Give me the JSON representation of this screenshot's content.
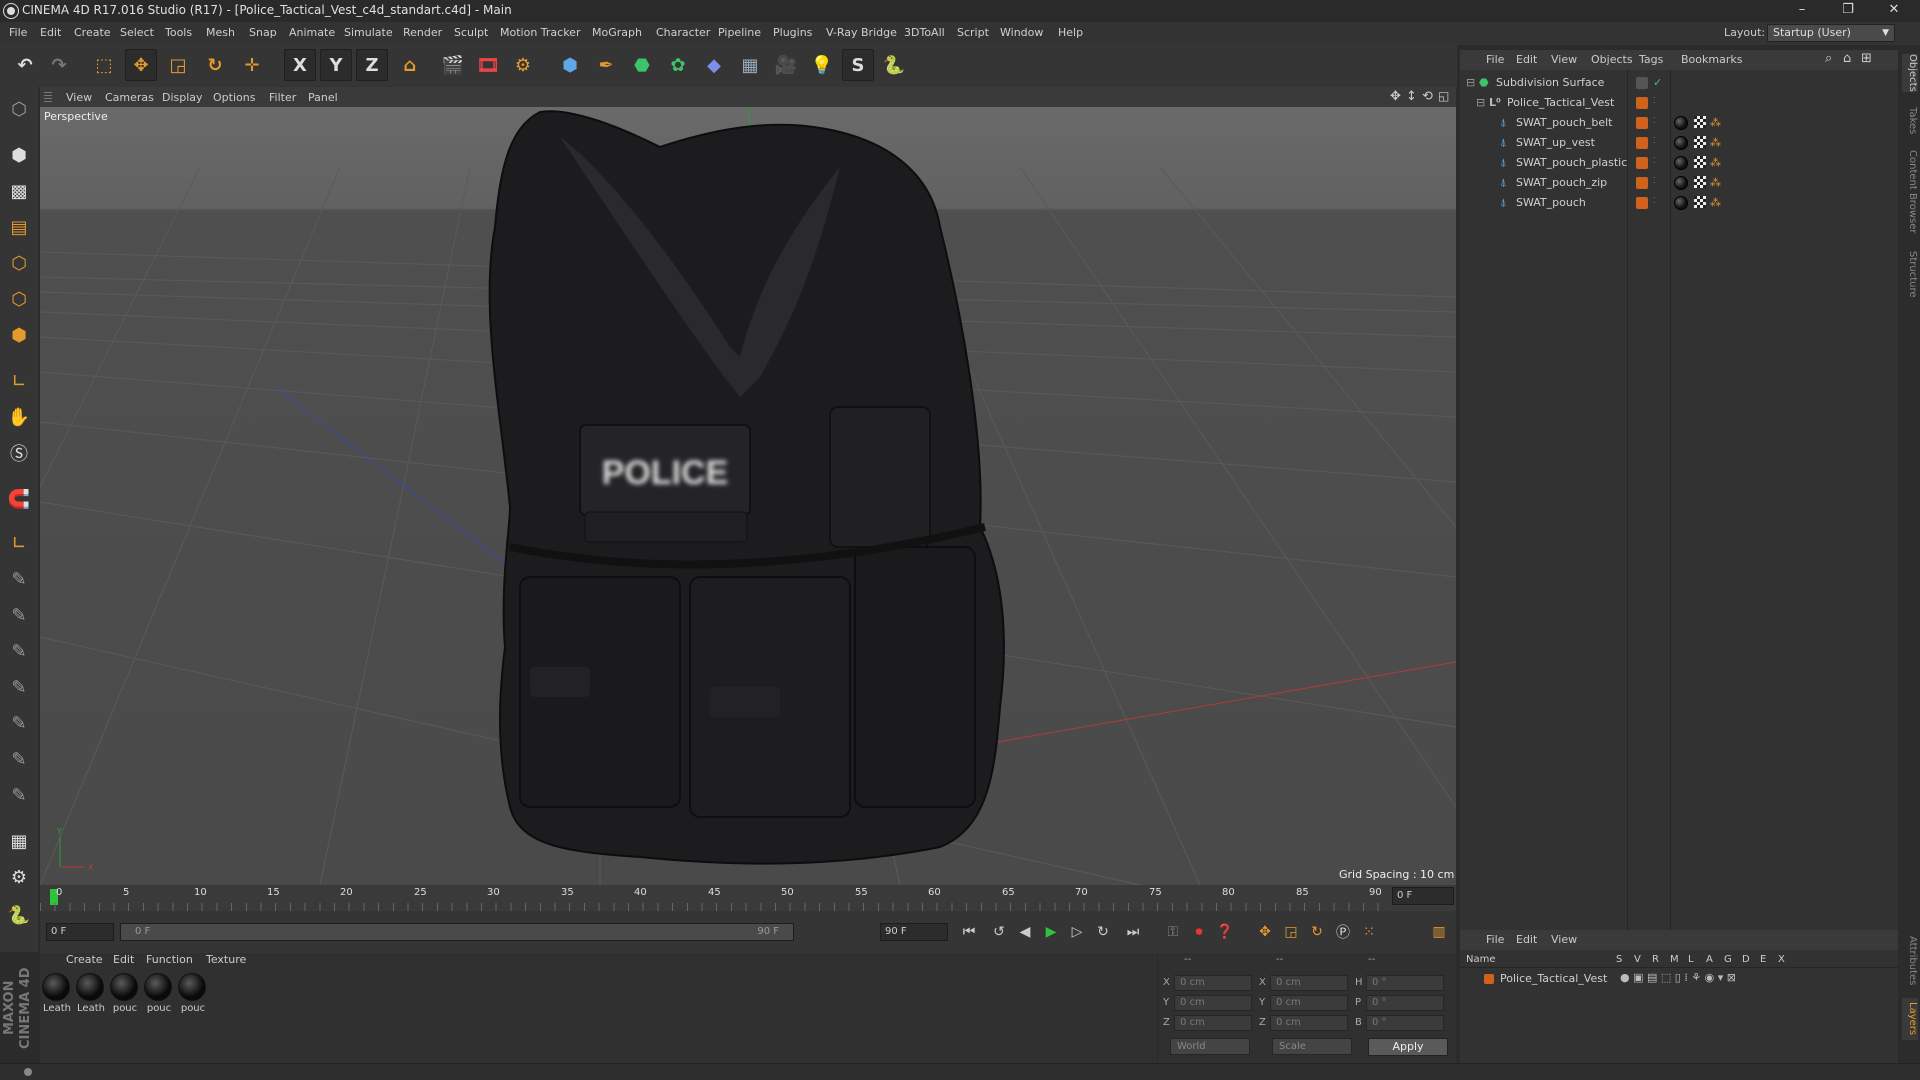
{
  "window": {
    "title": "CINEMA 4D R17.016 Studio (R17) - [Police_Tactical_Vest_c4d_standart.c4d] - Main",
    "minimize_glyph": "–",
    "restore_glyph": "❐",
    "close_glyph": "✕"
  },
  "menubar": {
    "items": [
      "File",
      "Edit",
      "Create",
      "Select",
      "Tools",
      "Mesh",
      "Snap",
      "Animate",
      "Simulate",
      "Render",
      "Sculpt",
      "Motion Tracker",
      "MoGraph",
      "Character",
      "Pipeline",
      "Plugins",
      "V-Ray Bridge",
      "3DToAll",
      "Script",
      "Window",
      "Help"
    ],
    "layout_label": "Layout:",
    "layout_value": "Startup (User)"
  },
  "toolbar": {
    "axis_x": "X",
    "axis_y": "Y",
    "axis_z": "Z"
  },
  "viewport": {
    "menu": [
      "View",
      "Cameras",
      "Display",
      "Options",
      "Filter",
      "Panel"
    ],
    "label": "Perspective",
    "grid_spacing": "Grid Spacing : 10 cm",
    "vest_patch_text": "POLICE",
    "axis_y": "Y",
    "axis_x": "X"
  },
  "timeline": {
    "ticks": [
      "0",
      "5",
      "10",
      "15",
      "20",
      "25",
      "30",
      "35",
      "40",
      "45",
      "50",
      "55",
      "60",
      "65",
      "70",
      "75",
      "80",
      "85",
      "90"
    ],
    "current_frame": "0 F"
  },
  "playbar": {
    "start_field": "0 F",
    "range_left": "0 F",
    "range_right": "90 F",
    "end_field": "90 F"
  },
  "material_manager": {
    "menu": [
      "Create",
      "Edit",
      "Function",
      "Texture"
    ],
    "materials": [
      "Leath",
      "Leath",
      "pouc",
      "pouc",
      "pouc"
    ]
  },
  "coordinates": {
    "header": [
      "--",
      "--",
      "--"
    ],
    "rows": [
      {
        "axis": "X",
        "pos": "0 cm",
        "size_axis": "X",
        "size": "0 cm",
        "rot_axis": "H",
        "rot": "0 °"
      },
      {
        "axis": "Y",
        "pos": "0 cm",
        "size_axis": "Y",
        "size": "0 cm",
        "rot_axis": "P",
        "rot": "0 °"
      },
      {
        "axis": "Z",
        "pos": "0 cm",
        "size_axis": "Z",
        "size": "0 cm",
        "rot_axis": "B",
        "rot": "0 °"
      }
    ],
    "mode_world": "World",
    "mode_scale": "Scale",
    "apply": "Apply"
  },
  "object_manager": {
    "menu": [
      "File",
      "Edit",
      "View",
      "Objects",
      "Tags",
      "Bookmarks"
    ],
    "objects": [
      {
        "name": "Subdivision Surface",
        "level": 0
      },
      {
        "name": "Police_Tactical_Vest",
        "level": 1
      },
      {
        "name": "SWAT_pouch_belt",
        "level": 2
      },
      {
        "name": "SWAT_up_vest",
        "level": 2
      },
      {
        "name": "SWAT_pouch_plastic",
        "level": 2
      },
      {
        "name": "SWAT_pouch_zip",
        "level": 2
      },
      {
        "name": "SWAT_pouch",
        "level": 2
      }
    ]
  },
  "attribute_manager": {
    "menu": [
      "File",
      "Edit",
      "View"
    ],
    "columns": [
      "Name",
      "S",
      "V",
      "R",
      "M",
      "L",
      "A",
      "G",
      "D",
      "E",
      "X"
    ],
    "layer_name": "Police_Tactical_Vest"
  },
  "right_tabs": [
    "Objects",
    "Takes",
    "Content Browser",
    "Structure",
    "Attributes",
    "Layers"
  ],
  "colors": {
    "accent_orange": "#e49a2d",
    "tag_orange": "#d0621c",
    "axis_green": "#2e9c2e",
    "axis_red": "#b23a3a",
    "axis_blue": "#3c4aa8"
  }
}
